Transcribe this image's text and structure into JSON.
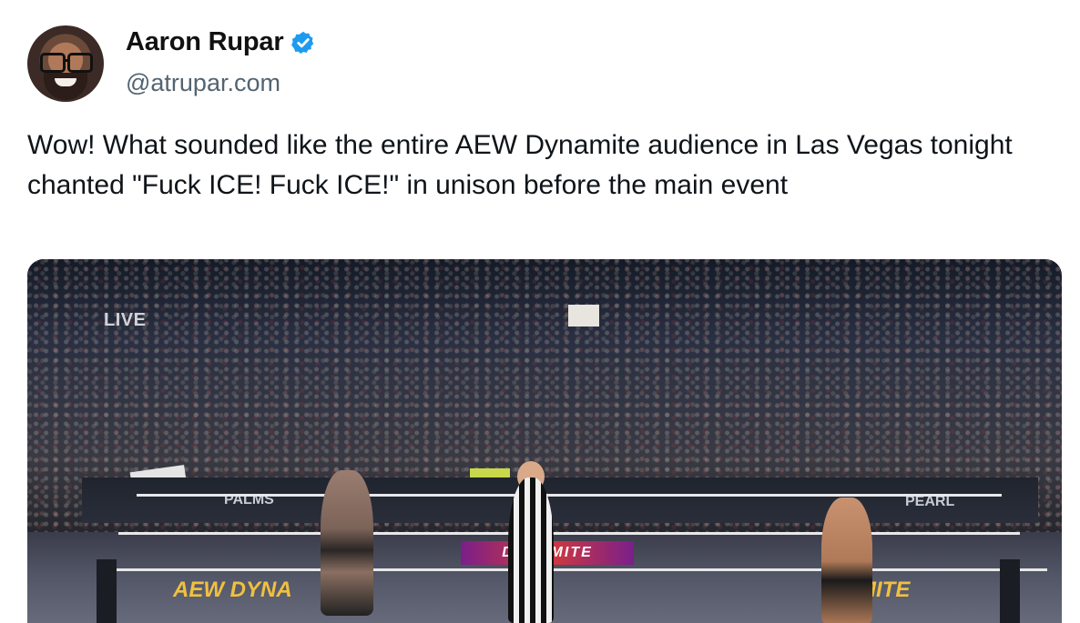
{
  "author": {
    "display_name": "Aaron Rupar",
    "handle": "@atrupar.com",
    "verified": true,
    "avatar_icon": "avatar-photo"
  },
  "tweet": {
    "text": "Wow! What sounded like the entire AEW Dynamite audience in Las Vegas tonight chanted \"Fuck ICE! Fuck ICE!\" in unison before the main event"
  },
  "media": {
    "live_label": "LIVE",
    "apron_left": "PALMS",
    "apron_right": "PEARL",
    "center_logo": "DYNAMITE",
    "corner_left": "AEW DYNA",
    "corner_right": "MITE"
  },
  "colors": {
    "verified_blue": "#1d9bf0",
    "handle_gray": "#536471",
    "text": "#0f1419"
  }
}
